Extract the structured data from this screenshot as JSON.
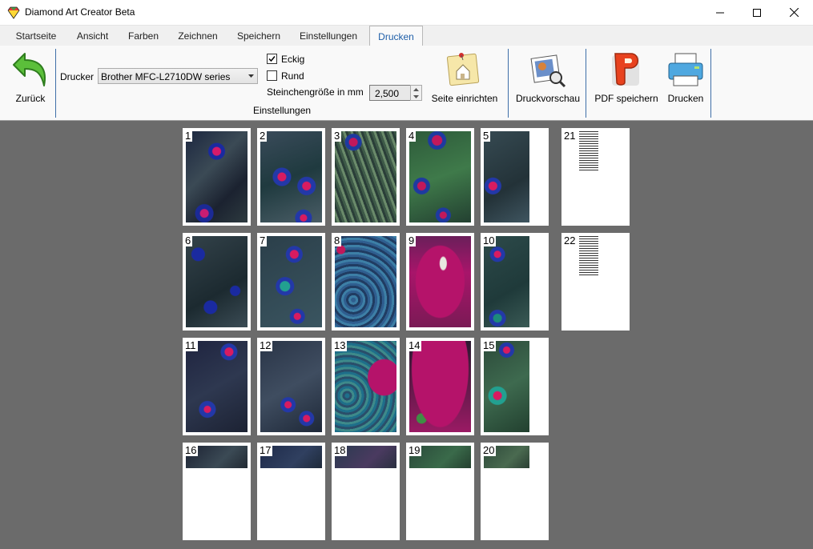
{
  "window": {
    "title": "Diamond Art Creator Beta"
  },
  "tabs": [
    {
      "label": "Startseite"
    },
    {
      "label": "Ansicht"
    },
    {
      "label": "Farben"
    },
    {
      "label": "Zeichnen"
    },
    {
      "label": "Speichern"
    },
    {
      "label": "Einstellungen"
    },
    {
      "label": "Drucken",
      "active": true
    }
  ],
  "ribbon": {
    "back_label": "Zurück",
    "printer_label": "Drucker",
    "printer_value": "Brother MFC-L2710DW series",
    "option_square_label": "Eckig",
    "option_square_checked": true,
    "option_round_label": "Rund",
    "option_round_checked": false,
    "stone_size_label": "Steinchengröße in mm",
    "stone_size_value": "2,500",
    "settings_group_label": "Einstellungen",
    "page_setup_label": "Seite einrichten",
    "print_preview_label": "Druckvorschau",
    "save_pdf_label": "PDF speichern",
    "print_label": "Drucken"
  },
  "icons": {
    "app": "diamond-icon",
    "back": "back-arrow-icon",
    "page_setup": "note-house-icon",
    "print_preview": "preview-icon",
    "pdf": "pdf-icon",
    "print": "printer-icon"
  },
  "pages": [
    {
      "num": "1"
    },
    {
      "num": "2"
    },
    {
      "num": "3"
    },
    {
      "num": "4"
    },
    {
      "num": "5"
    },
    {
      "num": "6"
    },
    {
      "num": "7"
    },
    {
      "num": "8"
    },
    {
      "num": "9"
    },
    {
      "num": "10"
    },
    {
      "num": "11"
    },
    {
      "num": "12"
    },
    {
      "num": "13"
    },
    {
      "num": "14"
    },
    {
      "num": "15"
    },
    {
      "num": "16"
    },
    {
      "num": "17"
    },
    {
      "num": "18"
    },
    {
      "num": "19"
    },
    {
      "num": "20"
    },
    {
      "num": "21"
    },
    {
      "num": "22"
    }
  ],
  "colors": {
    "accent": "#1e5ea8",
    "background": "#6b6b6b"
  }
}
